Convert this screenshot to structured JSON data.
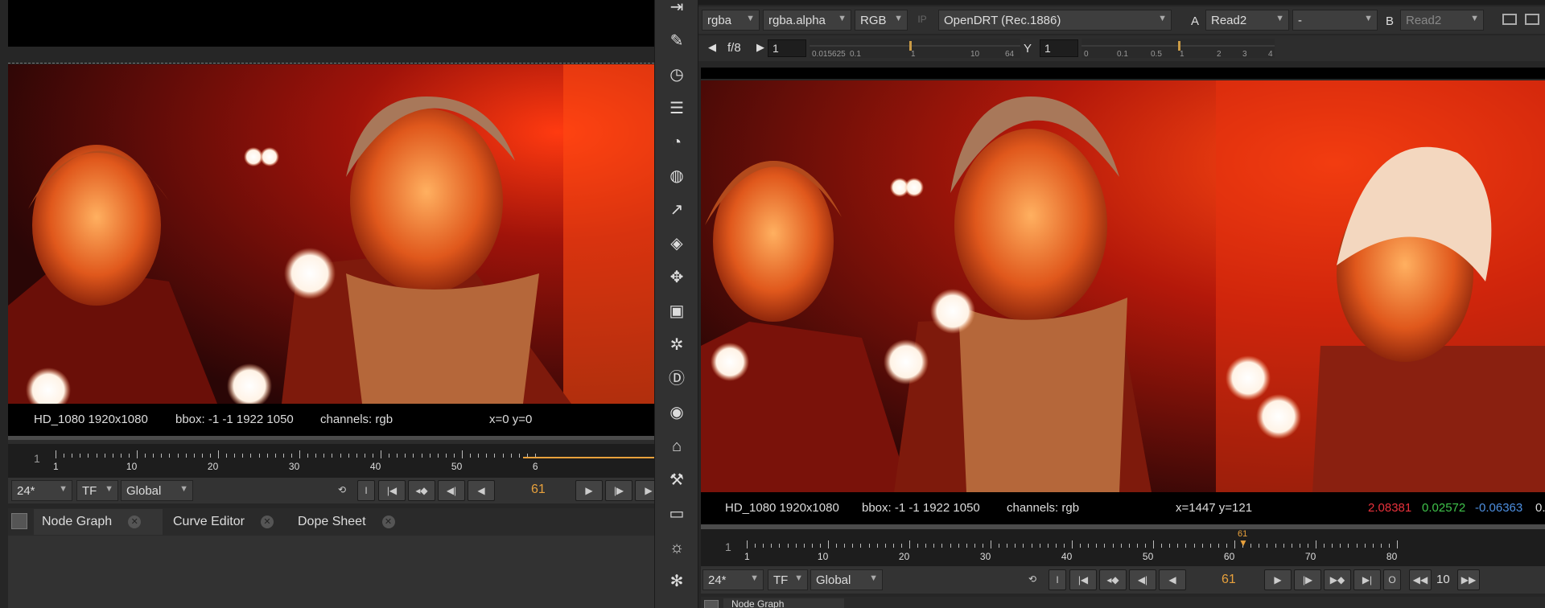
{
  "left_viewer": {
    "info_format": "HD_1080 1920x1080",
    "info_bbox": "bbox: -1 -1 1922 1050",
    "info_channels": "channels: rgb",
    "info_coords": "x=0 y=0",
    "timeline": {
      "start_frame": "1",
      "ticks": [
        "1",
        "10",
        "20",
        "30",
        "40",
        "50",
        "6"
      ]
    },
    "controls": {
      "fps": "24*",
      "tf": "TF",
      "global": "Global",
      "frame": "61",
      "in_point": "I"
    }
  },
  "left_tabs": [
    {
      "label": "Node Graph",
      "active": true
    },
    {
      "label": "Curve Editor",
      "active": false
    },
    {
      "label": "Dope Sheet",
      "active": false
    }
  ],
  "toolbar": {
    "icons": [
      "import-icon",
      "brush-icon",
      "clock-icon",
      "stack-icon",
      "color-wheel-icon",
      "sphere-icon",
      "transform-icon",
      "layers-icon",
      "move-icon",
      "cube-icon",
      "particles-icon",
      "deep-icon",
      "eye-icon",
      "tag-icon",
      "tools-icon",
      "metadata-icon",
      "fire-icon",
      "nodes-icon",
      "more-icon"
    ]
  },
  "right_viewer": {
    "header": {
      "channels": "rgba",
      "alpha": "rgba.alpha",
      "display": "RGB",
      "ip": "IP",
      "lut": "OpenDRT (Rec.1886)",
      "a_label": "A",
      "a_input": "Read2",
      "mid": "-",
      "b_label": "B",
      "b_input": "Read2"
    },
    "gain": {
      "fstop": "f/8",
      "gain_value": "1",
      "gain_scale": [
        "0.015625",
        "0.1",
        "1",
        "10",
        "64"
      ],
      "gamma_label": "Y",
      "gamma_value": "1",
      "gamma_scale": [
        "0",
        "0.1",
        "0.5",
        "1",
        "2",
        "3",
        "4"
      ]
    },
    "info_format": "HD_1080 1920x1080",
    "info_bbox": "bbox: -1 -1 1922 1050",
    "info_channels": "channels: rgb",
    "info_coords": "x=1447 y=121",
    "pixel_r": "2.08381",
    "pixel_g": "0.02572",
    "pixel_b": "-0.06363",
    "pixel_a": "0.",
    "colors": {
      "r": "#e8313b",
      "g": "#3fc24a",
      "b": "#4d8fe0"
    },
    "timeline": {
      "start_frame": "1",
      "ticks": [
        "1",
        "10",
        "20",
        "30",
        "40",
        "50",
        "60",
        "70",
        "80"
      ],
      "playhead": "61"
    },
    "controls": {
      "fps": "24*",
      "tf": "TF",
      "global": "Global",
      "frame": "61",
      "in_point": "I",
      "out_point": "O",
      "step": "10"
    }
  },
  "right_tabs": [
    {
      "label": "Node Graph",
      "active": true
    }
  ]
}
